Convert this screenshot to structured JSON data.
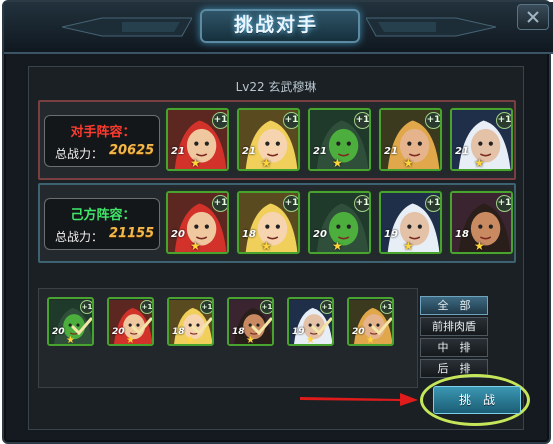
{
  "dialog": {
    "title": "挑战对手"
  },
  "opponent": {
    "name": "Lv22 玄武穆琳"
  },
  "enemy_lineup": {
    "label": "对手阵容：",
    "power_label": "总战力：",
    "power_value": "20625",
    "cards": [
      {
        "level": "21",
        "plus": "+1",
        "hero": "red-haired-warrior"
      },
      {
        "level": "21",
        "plus": "+1",
        "hero": "blonde-elf-archer"
      },
      {
        "level": "21",
        "plus": "+1",
        "hero": "green-orc"
      },
      {
        "level": "21",
        "plus": "+1",
        "hero": "dwarf-warrior"
      },
      {
        "level": "21",
        "plus": "+1",
        "hero": "frost-dwarf"
      }
    ]
  },
  "own_lineup": {
    "label": "己方阵容：",
    "power_label": "总战力：",
    "power_value": "21155",
    "cards": [
      {
        "level": "20",
        "plus": "+1",
        "hero": "red-haired-warrior"
      },
      {
        "level": "18",
        "plus": "+1",
        "hero": "blonde-elf-archer"
      },
      {
        "level": "20",
        "plus": "+1",
        "hero": "green-orc"
      },
      {
        "level": "19",
        "plus": "+1",
        "hero": "frost-dwarf"
      },
      {
        "level": "18",
        "plus": "+1",
        "hero": "goggled-engineer"
      }
    ]
  },
  "reserve": {
    "cards": [
      {
        "level": "20",
        "plus": "+1",
        "hero": "green-orc"
      },
      {
        "level": "20",
        "plus": "+1",
        "hero": "red-haired-warrior"
      },
      {
        "level": "18",
        "plus": "+1",
        "hero": "blonde-elf-archer"
      },
      {
        "level": "18",
        "plus": "+1",
        "hero": "goggled-engineer"
      },
      {
        "level": "19",
        "plus": "+1",
        "hero": "frost-dwarf"
      },
      {
        "level": "20",
        "plus": "+1",
        "hero": "dwarf-warrior"
      }
    ]
  },
  "filters": {
    "all": "全　部",
    "front": "前排肉盾",
    "middle": "中　排",
    "back": "后　排"
  },
  "actions": {
    "challenge": "挑　战"
  },
  "colors": {
    "accent": "#3b97b3",
    "enemy_label": "#ff3b2f",
    "own_label": "#40e66a",
    "power_value": "#f2b94a",
    "highlight_ring": "#c5e65a",
    "arrow": "#e01b1b"
  }
}
